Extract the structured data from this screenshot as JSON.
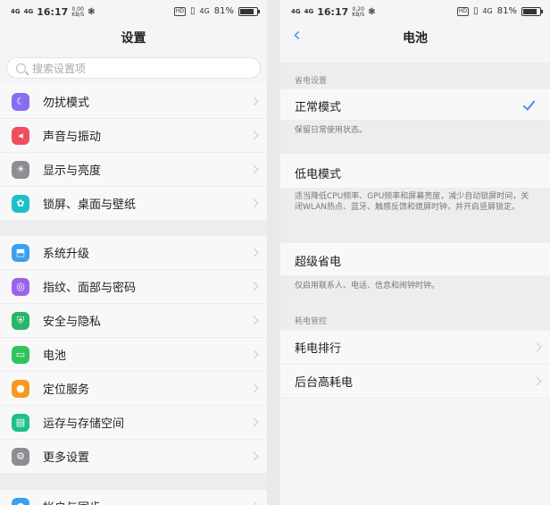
{
  "left": {
    "status": {
      "net1": "4G",
      "net2": "4G",
      "time": "16:17",
      "speed_value": "0.00",
      "speed_unit": "KB/S",
      "hd": "HD",
      "net4g": "4G",
      "battery": "81%",
      "battery_level": 0.81
    },
    "title": "设置",
    "search": {
      "placeholder": "搜索设置项"
    },
    "items": [
      {
        "label": "勿扰模式",
        "icon": "moon-icon",
        "color": "#8a6cf0"
      },
      {
        "label": "声音与振动",
        "icon": "speaker-icon",
        "color": "#ef4f5d"
      },
      {
        "label": "显示与亮度",
        "icon": "brightness-icon",
        "color": "#8d8d93"
      },
      {
        "label": "锁屏、桌面与壁纸",
        "icon": "palette-icon",
        "color": "#1cc0c9"
      },
      {
        "label": "系统升级",
        "icon": "system-update-icon",
        "color": "#3aa0f0"
      },
      {
        "label": "指纹、面部与密码",
        "icon": "fingerprint-icon",
        "color": "#9b64e8"
      },
      {
        "label": "安全与隐私",
        "icon": "shield-icon",
        "color": "#28b46a"
      },
      {
        "label": "电池",
        "icon": "battery-icon",
        "color": "#2fc45a"
      },
      {
        "label": "定位服务",
        "icon": "location-icon",
        "color": "#f59a1f"
      },
      {
        "label": "运存与存储空间",
        "icon": "storage-icon",
        "color": "#1fbf88"
      },
      {
        "label": "更多设置",
        "icon": "more-settings-icon",
        "color": "#8d8d93"
      },
      {
        "label": "帐户与同步",
        "icon": "account-icon",
        "color": "#3aa0f0"
      }
    ]
  },
  "right": {
    "status": {
      "net1": "4G",
      "net2": "4G",
      "time": "16:17",
      "speed_value": "0.20",
      "speed_unit": "KB/S",
      "hd": "HD",
      "net4g": "4G",
      "battery": "81%",
      "battery_level": 0.81
    },
    "title": "电池",
    "back_icon": "back-arrow-icon",
    "section1": "省电设置",
    "normal_mode": {
      "title": "正常模式",
      "desc": "保留日常使用状态。"
    },
    "low_mode": {
      "title": "低电模式",
      "desc": "适当降低CPU频率、GPU频率和屏幕亮度，减少自动锁屏时间，关闭WLAN热点、蓝牙、触感反馈和熄屏时钟，并开启竖屏锁定。"
    },
    "super_mode": {
      "title": "超级省电",
      "desc": "仅启用联系人、电话、信息和闹钟时钟。"
    },
    "section2": "耗电管控",
    "rank": "耗电排行",
    "background": "后台高耗电",
    "accent": "#4a90e2"
  }
}
